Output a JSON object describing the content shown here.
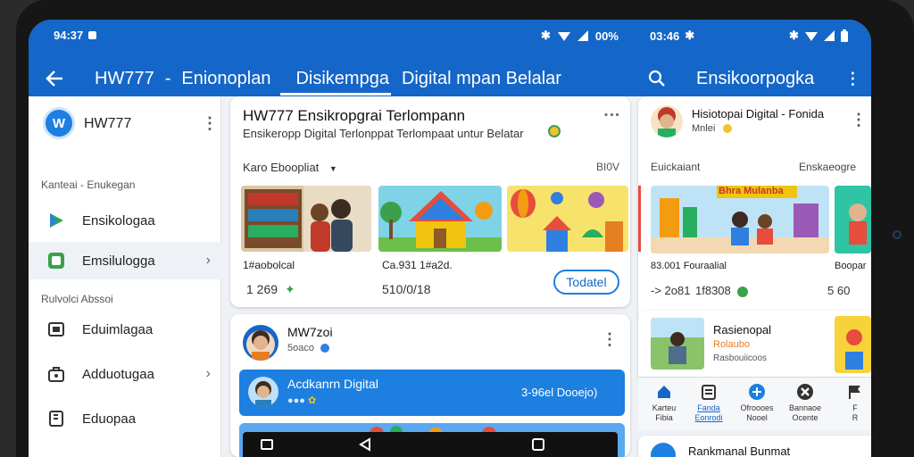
{
  "status_left": {
    "time": "94:37",
    "battery": "00%"
  },
  "status_right": {
    "time": "03:46"
  },
  "appbar_left": {
    "title": "HW777",
    "sep": "-",
    "tab1": "Enionoplan",
    "tab2": "Disikempga",
    "tab3": "Digital mpan Belalar"
  },
  "appbar_right": {
    "title": "Ensikoorpogka"
  },
  "sidebar": {
    "title": "HW777",
    "logo_text": "W",
    "section1": "Kanteai - Enukegan",
    "section2": "Rulvolci Abssoi",
    "items": [
      {
        "label": "Ensikologaa",
        "icon": "play-icon"
      },
      {
        "label": "Emsilulogga",
        "icon": "tablet-icon"
      },
      {
        "label": "Eduimlagaa",
        "icon": "screen-icon"
      },
      {
        "label": "Adduotugaa",
        "icon": "briefcase-icon"
      },
      {
        "label": "Eduopaa",
        "icon": "book-icon"
      }
    ]
  },
  "main_card": {
    "title": "HW777 Ensikropgrai Terlompann",
    "subtitle": "Ensikeropp Digital Terlonppat Terlompaat untur Belatar",
    "filter_label": "Karo Eboopliat",
    "filter_right": "BI0V",
    "caption1": "1#aobolcal",
    "caption2": "Ca.931 1#a2d.",
    "stat1": "1 269",
    "stat2": "510/0/18",
    "button": "Todatel"
  },
  "post_card": {
    "name": "MW7zoi",
    "handle": "5oaco",
    "banner_title": "Acdkanrn Digital",
    "banner_right": "3-96el Dooejo)"
  },
  "right_card": {
    "title": "Hisiotopai Digital - Fonida",
    "subtitle": "Mnlei",
    "label_left": "Euickaiant",
    "label_right": "Enskaeogre",
    "thumb_label": "Bhra Mulanba",
    "caption1": "83.001 Fouraalial",
    "caption2": "Boopar",
    "stat1": "-> 2o81",
    "stat2": "1f8308",
    "stat3": "5 60"
  },
  "right_list": {
    "title": "Rasienopal",
    "subtitle": "Rolaubo",
    "meta": "Rasbouiicoos"
  },
  "bottom_nav": [
    {
      "label": "Karteu\nFibia",
      "icon": "home-icon"
    },
    {
      "label": "Fanda\nEonrodi",
      "icon": "clipboard-icon"
    },
    {
      "label": "Ofroooes\nNooel",
      "icon": "plus-icon"
    },
    {
      "label": "Bannaoe\nOcente",
      "icon": "tools-icon"
    },
    {
      "label": "F\nR",
      "icon": "flag-icon"
    }
  ],
  "bottom_peek": {
    "title": "Rankmanal Bunmat"
  },
  "colors": {
    "accent": "#1466c8",
    "accent_light": "#1d7fe0",
    "green": "#3aa14a"
  }
}
